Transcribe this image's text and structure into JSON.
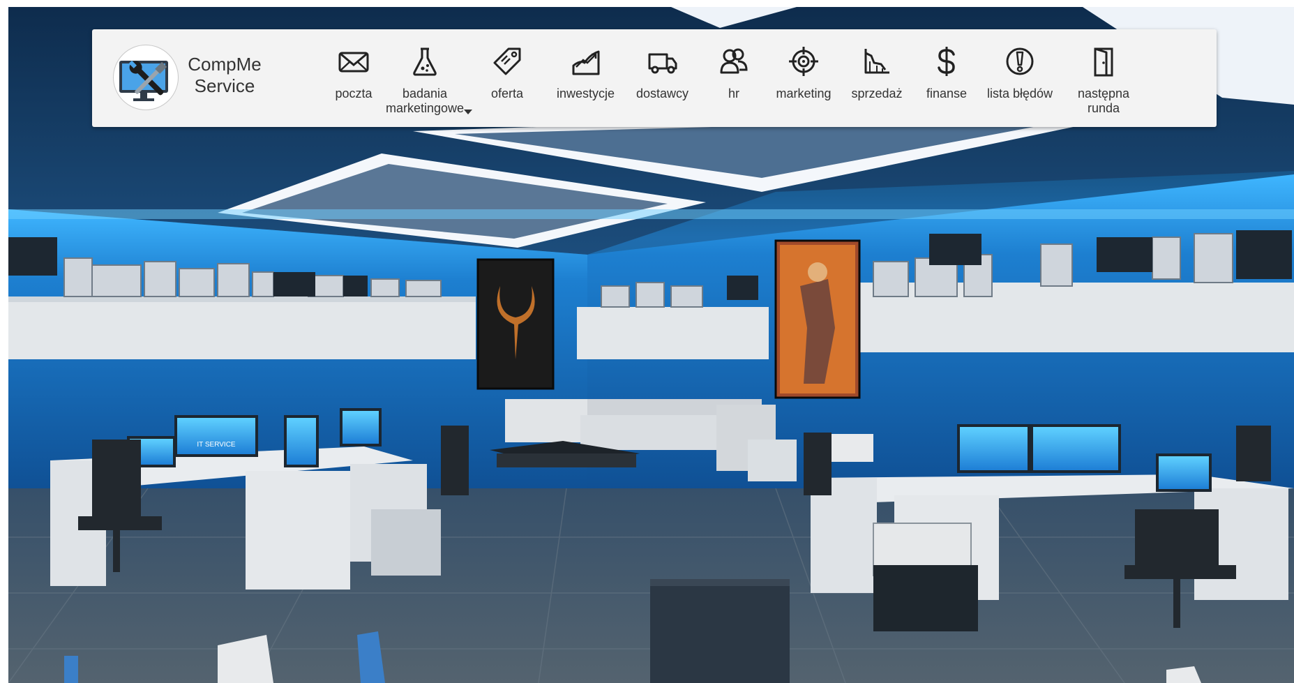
{
  "brand": {
    "line1": "CompMe",
    "line2": "Service"
  },
  "nav": [
    {
      "id": "poczta",
      "label": "poczta",
      "icon": "envelope-icon"
    },
    {
      "id": "badania",
      "label_line1": "badania",
      "label_line2": "marketingowe",
      "icon": "flask-icon",
      "has_dropdown": true
    },
    {
      "id": "oferta",
      "label": "oferta",
      "icon": "tag-icon"
    },
    {
      "id": "inwestycje",
      "label": "inwestycje",
      "icon": "growth-chart-icon"
    },
    {
      "id": "dostawcy",
      "label": "dostawcy",
      "icon": "delivery-truck-icon"
    },
    {
      "id": "hr",
      "label": "hr",
      "icon": "people-icon"
    },
    {
      "id": "marketing",
      "label": "marketing",
      "icon": "target-icon"
    },
    {
      "id": "sprzedaz",
      "label": "sprzedaż",
      "icon": "sales-chart-icon"
    },
    {
      "id": "finanse",
      "label": "finanse",
      "icon": "dollar-icon"
    },
    {
      "id": "lista",
      "label": "lista błędów",
      "icon": "exclamation-circle-icon"
    },
    {
      "id": "runda",
      "label_line1": "następna",
      "label_line2": "runda",
      "icon": "door-icon"
    }
  ],
  "scene": {
    "monitor_text": "IT SERVICE",
    "accent_light": "#3fb6ff",
    "wall": "#1f6dae"
  }
}
